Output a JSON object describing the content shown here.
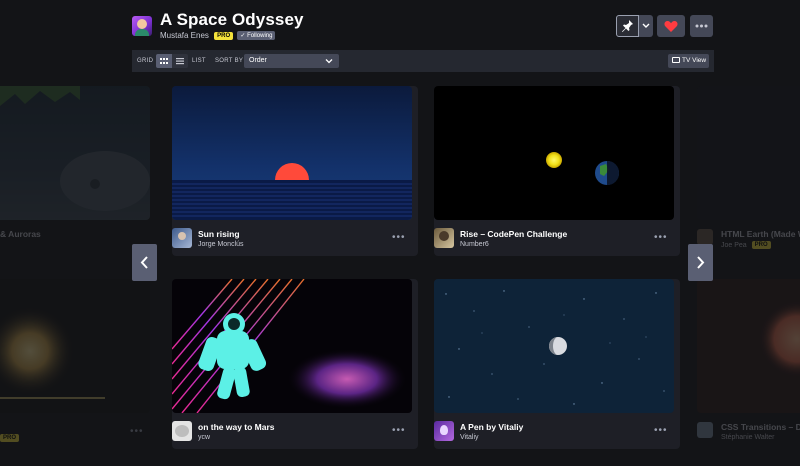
{
  "header": {
    "title": "A Space Odyssey",
    "owner": "Mustafa Enes",
    "pro_badge": "PRO",
    "following_badge": "✓ Following"
  },
  "toolbar": {
    "grid_label": "GRID",
    "list_label": "LIST",
    "sort_label": "SORT BY",
    "sort_value": "Order",
    "tv_label": "TV View"
  },
  "icons": {
    "pin": "pin-icon",
    "heart": "heart-icon",
    "more": "more-icon",
    "grid": "grid-icon",
    "list": "list-icon",
    "tv": "tv-icon",
    "prev": "chevron-left-icon",
    "next": "chevron-right-icon"
  },
  "colors": {
    "background": "#131417",
    "card": "#1e1f26",
    "heart": "#ff3c41",
    "pro": "#f4e23b"
  },
  "cards": [
    {
      "title": "Sun rising",
      "author": "Jorge Monclús"
    },
    {
      "title": "Rise – CodePen Challenge",
      "author": "Number6"
    },
    {
      "title": "on the way to Mars",
      "author": "ycw"
    },
    {
      "title": "A Pen by Vitaliy",
      "author": "Vitaliy"
    }
  ],
  "side_cards": {
    "left_top_title": "& Auroras",
    "left_bottom_badge": "PRO",
    "right_top_title": "HTML Earth (Made W",
    "right_top_author": "Joe Pea",
    "right_top_badge": "PRO",
    "right_bottom_title": "CSS Transitions – D",
    "right_bottom_author": "Stéphanie Walter"
  },
  "more_glyph": "•••",
  "prev_glyph": "‹",
  "next_glyph": "›"
}
